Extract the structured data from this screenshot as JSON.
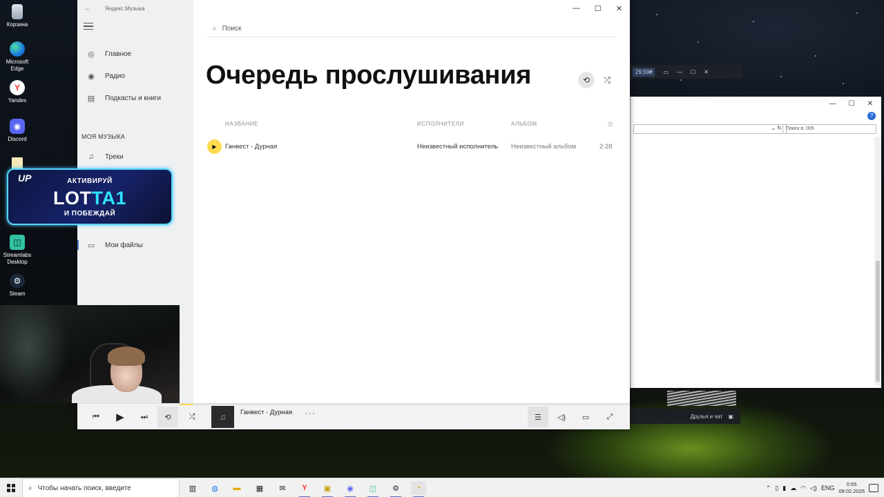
{
  "desktop": {
    "icons": [
      {
        "label": "Корзина",
        "icon": "recycle-bin-icon"
      },
      {
        "label": "Microsoft Edge",
        "icon": "edge-icon"
      },
      {
        "label": "Yandex",
        "icon": "yandex-browser-icon"
      },
      {
        "label": "Discord",
        "icon": "discord-icon"
      },
      {
        "label": "Streamlabs Desktop",
        "icon": "streamlabs-icon"
      },
      {
        "label": "Steam",
        "icon": "steam-icon"
      }
    ]
  },
  "app": {
    "title": "Яндекс.Музыка",
    "window_controls": {
      "minimize": "—",
      "maximize": "☐",
      "close": "✕"
    }
  },
  "sidebar": {
    "items": [
      {
        "label": "Главное",
        "icon": "home-icon"
      },
      {
        "label": "Радио",
        "icon": "radio-icon"
      },
      {
        "label": "Подкасты и книги",
        "icon": "podcasts-icon"
      }
    ],
    "section_title": "МОЯ МУЗЫКА",
    "my_music": [
      {
        "label": "Треки",
        "icon": "note-icon"
      },
      {
        "label": "Мои файлы",
        "icon": "folder-icon"
      }
    ]
  },
  "search": {
    "placeholder": "Поиск"
  },
  "queue": {
    "title": "Очередь прослушивания",
    "columns": {
      "title": "НАЗВАНИЕ",
      "artists": "ИСПОЛНИТЕЛИ",
      "album": "АЛЬБОМ"
    },
    "tracks": [
      {
        "title": "Ганвест - Дурная",
        "artist": "Неизвестный исполнитель",
        "album": "Неизвестный альбом",
        "duration": "2:28"
      }
    ]
  },
  "player": {
    "now_playing": "Ганвест - Дурная",
    "progress_fraction": 0.03,
    "more": "···"
  },
  "promo": {
    "badge": "UP",
    "line1": "АКТИВИРУЙ",
    "code_part1": "LOT",
    "code_part2": "TA1",
    "line2": "И ПОБЕЖДАЙ"
  },
  "background_window": {
    "search_placeholder": "Поиск в: 005",
    "obs_value": "29,59₴",
    "friends_label": "Друзья и чат"
  },
  "taskbar": {
    "search_placeholder": "Чтобы начать поиск, введите",
    "language": "ENG",
    "time": "0:55",
    "date": "09.02.2026"
  },
  "colors": {
    "accent": "#ffdb4d",
    "promo_cyan": "#2fe3ff",
    "sidebar_bg": "#eff0f2"
  }
}
